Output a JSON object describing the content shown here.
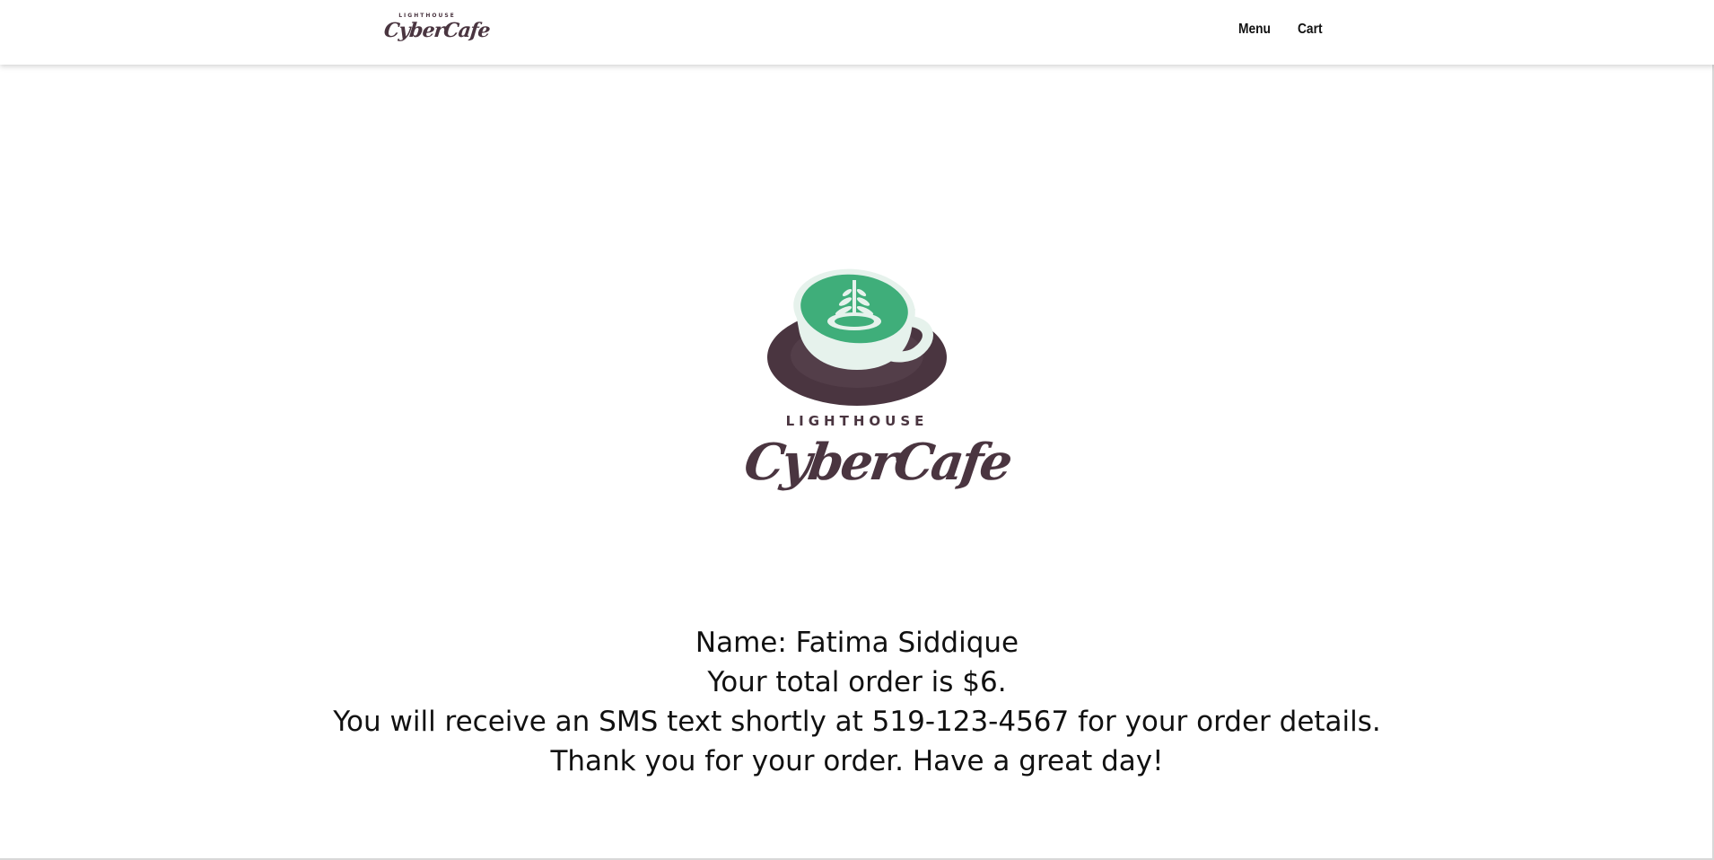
{
  "navbar": {
    "logo": {
      "top_text": "LIGHTHOUSE",
      "script_text": "CyberCafe"
    },
    "links": [
      {
        "label": "Menu"
      },
      {
        "label": "Cart"
      }
    ]
  },
  "hero_logo": {
    "top_text": "LIGHTHOUSE",
    "script_text": "CyberCafe",
    "colors": {
      "brand_dark": "#4a3540",
      "latte_green": "#3fae7a",
      "cup_white": "#e6f2ec"
    },
    "icon": "latte-cup-icon"
  },
  "confirmation": {
    "name_line": "Name: Fatima Siddique",
    "total_line": "Your total order is $6.",
    "sms_line": "You will receive an SMS text shortly at 519-123-4567 for your order details.",
    "thanks_line": "Thank you for your order. Have a great day!"
  }
}
